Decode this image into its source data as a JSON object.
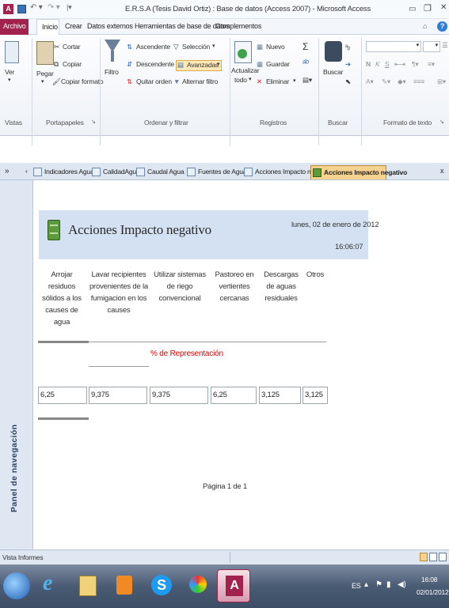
{
  "window": {
    "title": "E.R.S.A (Tesis David Ortiz) : Base de datos (Access 2007) - Microsoft Access"
  },
  "ribbon_tabs": [
    "Archivo",
    "Inicio",
    "Crear",
    "Datos externos",
    "Herramientas de base de datos",
    "Complementos"
  ],
  "ribbon": {
    "ver": "Ver",
    "pegar": "Pegar",
    "cortar": "Cortar",
    "copiar": "Copiar",
    "copiar_formato": "Copiar formato",
    "filtro": "Filtro",
    "ascendente": "Ascendente",
    "descendente": "Descendente",
    "quitar_orden": "Quitar orden",
    "seleccion": "Selección",
    "avanzadas": "Avanzadas",
    "alternar_filtro": "Alternar filtro",
    "actualizar": "Actualizar",
    "todo": "todo",
    "nuevo": "Nuevo",
    "guardar": "Guardar",
    "eliminar": "Eliminar",
    "buscar": "Buscar",
    "groups": [
      "Vistas",
      "Portapapeles",
      "Ordenar y filtrar",
      "Registros",
      "Buscar",
      "Formato de texto"
    ]
  },
  "doc_tabs": [
    "Indicadores Agua",
    "CalidadAgua",
    "Caudal Agua",
    "Fuentes de Agua",
    "Acciones Impacto negativo",
    "Acciones Impacto negativo"
  ],
  "nav_pane": {
    "label": "Panel de navegación"
  },
  "report": {
    "title": "Acciones Impacto negativo",
    "date": "lunes, 02 de enero de 2012",
    "time": "16:06:07",
    "columns": [
      "Arrojar residuos sólidos a los causes de agua",
      "Lavar recipientes provenientes de la fumigacion en los causes",
      "Utilizar sistemas de riego convencional",
      "Pastoreo en vertientes cercanas",
      "Descargas de aguas residuales",
      "Otros"
    ],
    "section_label": "% de Representación",
    "values": [
      "6,25",
      "9,375",
      "9,375",
      "6,25",
      "3,125",
      "3,125"
    ],
    "page": "Página 1 de 1"
  },
  "status": {
    "left": "Vista Informes"
  },
  "taskbar": {
    "lang": "ES",
    "time": "16:08",
    "date": "02/01/2012"
  },
  "colors": {
    "archivo_tab": "#a1224c",
    "report_header": "#d3e1f2",
    "section_label": "#e00000",
    "active_doc_tab": "#f6d28f"
  }
}
